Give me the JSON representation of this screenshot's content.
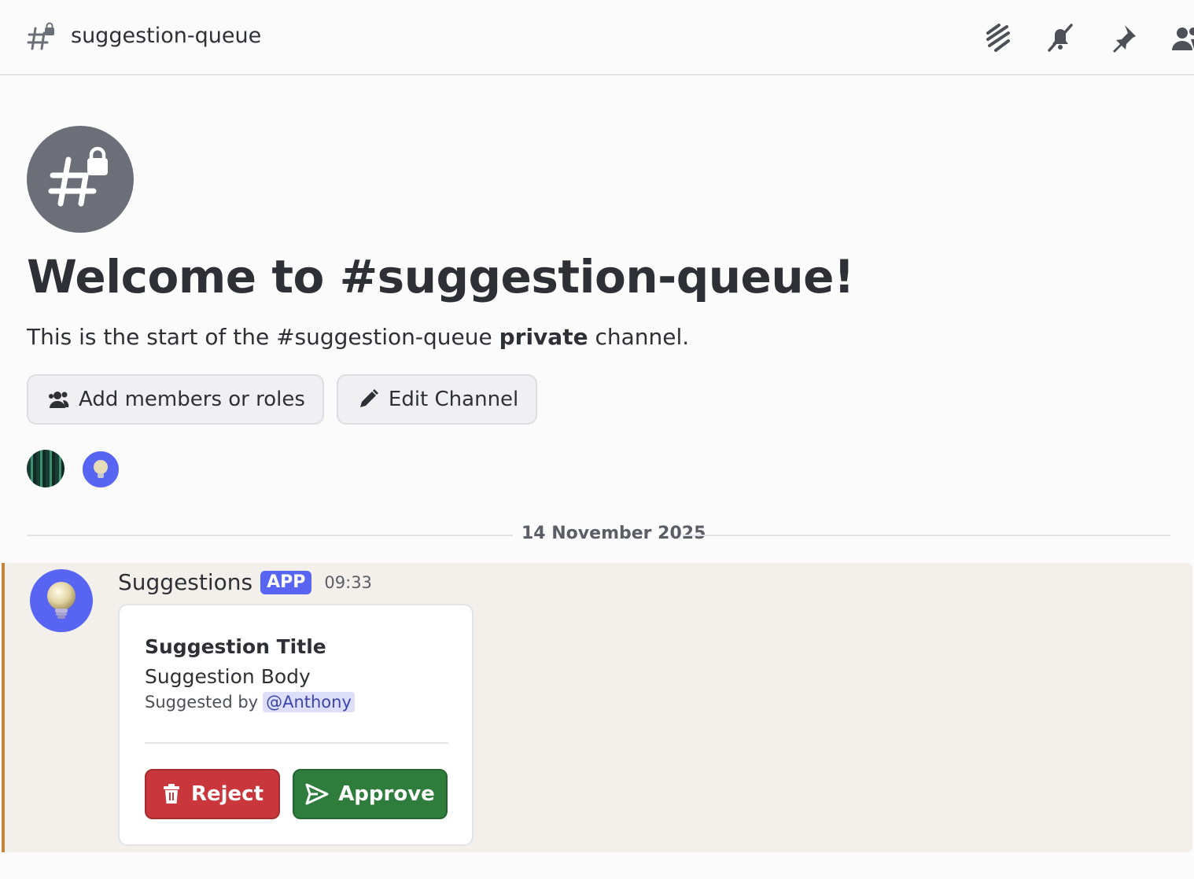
{
  "header": {
    "channel_icon": "hashtag-lock-icon",
    "channel_name": "suggestion-queue",
    "actions": [
      "threads-icon",
      "mute-bell-icon",
      "pin-icon",
      "members-icon"
    ]
  },
  "welcome": {
    "avatar_icon": "hashtag-lock-icon",
    "title": "Welcome to #suggestion-queue!",
    "desc_pre": "This is the start of the #suggestion-queue ",
    "desc_bold": "private",
    "desc_post": " channel.",
    "buttons": {
      "add_members": "Add members or roles",
      "edit_channel": "Edit Channel"
    }
  },
  "date_divider": "14 November 2025",
  "message": {
    "author": "Suggestions",
    "badge": "APP",
    "time": "09:33",
    "card": {
      "title": "Suggestion Title",
      "body": "Suggestion Body",
      "suggested_by_label": "Suggested by",
      "mention": "@Anthony",
      "reject_label": "Reject",
      "approve_label": "Approve"
    }
  },
  "colors": {
    "accent": "#5865f2",
    "reject": "#c9373d",
    "approve": "#2f7d3c",
    "highlight_border": "#c0843a"
  }
}
